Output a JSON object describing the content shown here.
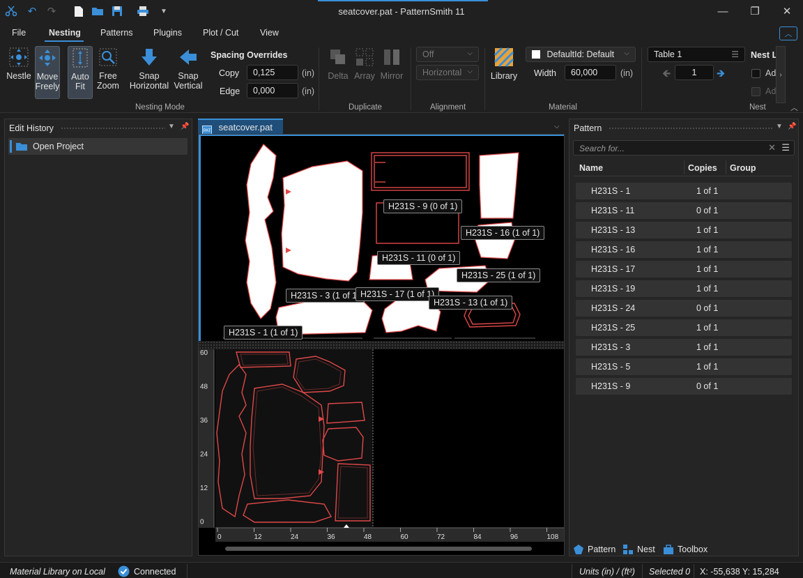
{
  "window": {
    "title": "seatcover.pat - PatternSmith 11"
  },
  "menu": [
    "File",
    "Nesting",
    "Patterns",
    "Plugins",
    "Plot / Cut",
    "View"
  ],
  "ribbon": {
    "nesting_mode": {
      "label": "Nesting Mode",
      "nestle": "Nestle",
      "move_freely": [
        "Move",
        "Freely"
      ],
      "auto_fit": [
        "Auto",
        "Fit"
      ],
      "free_zoom": [
        "Free",
        "Zoom"
      ],
      "snap_horizontal": [
        "Snap",
        "Horizontal"
      ],
      "snap_vertical": [
        "Snap",
        "Vertical"
      ],
      "spacing_title": "Spacing Overrides",
      "copy_label": "Copy",
      "copy_value": "0,125",
      "edge_label": "Edge",
      "edge_value": "0,000",
      "unit": "(in)"
    },
    "duplicate": {
      "label": "Duplicate",
      "delta": "Delta",
      "array": "Array",
      "mirror": "Mirror"
    },
    "alignment": {
      "label": "Alignment",
      "mode": "Off",
      "direction": "Horizontal"
    },
    "material": {
      "label": "Material",
      "library": "Library",
      "default": "DefaultId: Default",
      "width_label": "Width",
      "width_value": "60,000",
      "unit": "(in)"
    },
    "nest": {
      "label": "Nest",
      "table": "Table 1",
      "page": "1",
      "title": "Nest Lo",
      "opt1": "Add",
      "opt2": "Add"
    }
  },
  "edit_history": {
    "title": "Edit History",
    "items": [
      "Open Project"
    ]
  },
  "document": {
    "tab": "seatcover.pat",
    "labels": [
      "H231S - 9 (0 of 1)",
      "H231S - 16 (1 of 1)",
      "H231S - 11 (0 of 1)",
      "H231S - 25 (1 of 1)",
      "H231S - 3 (1 of 1)",
      "H231S - 17 (1 of 1)",
      "H231S - 13 (1 of 1)",
      "H231S - 1 (1 of 1)"
    ],
    "x_ticks": [
      "0",
      "12",
      "24",
      "36",
      "48",
      "60",
      "72",
      "84",
      "96",
      "108"
    ],
    "y_ticks": [
      "60",
      "48",
      "36",
      "24",
      "12",
      "0"
    ]
  },
  "pattern_panel": {
    "title": "Pattern",
    "search_placeholder": "Search for...",
    "columns": [
      "Name",
      "Copies",
      "Group"
    ],
    "rows": [
      {
        "name": "H231S - 1",
        "copies": "1 of 1"
      },
      {
        "name": "H231S - 11",
        "copies": "0 of 1"
      },
      {
        "name": "H231S - 13",
        "copies": "1 of 1"
      },
      {
        "name": "H231S - 16",
        "copies": "1 of 1"
      },
      {
        "name": "H231S - 17",
        "copies": "1 of 1"
      },
      {
        "name": "H231S - 19",
        "copies": "1 of 1"
      },
      {
        "name": "H231S - 24",
        "copies": "0 of 1"
      },
      {
        "name": "H231S - 25",
        "copies": "1 of 1"
      },
      {
        "name": "H231S - 3",
        "copies": "1 of 1"
      },
      {
        "name": "H231S - 5",
        "copies": "1 of 1"
      },
      {
        "name": "H231S - 9",
        "copies": "0 of 1"
      }
    ],
    "tabs": [
      "Pattern",
      "Nest",
      "Toolbox"
    ]
  },
  "status": {
    "library": "Material Library on Local",
    "connected": "Connected",
    "units": "Units (in) / (ft²)",
    "selected": "Selected 0",
    "coords": "X: -55,638 Y: 15,284"
  },
  "colors": {
    "accent": "#3b8fd8",
    "pattern_outline": "#e04848"
  }
}
